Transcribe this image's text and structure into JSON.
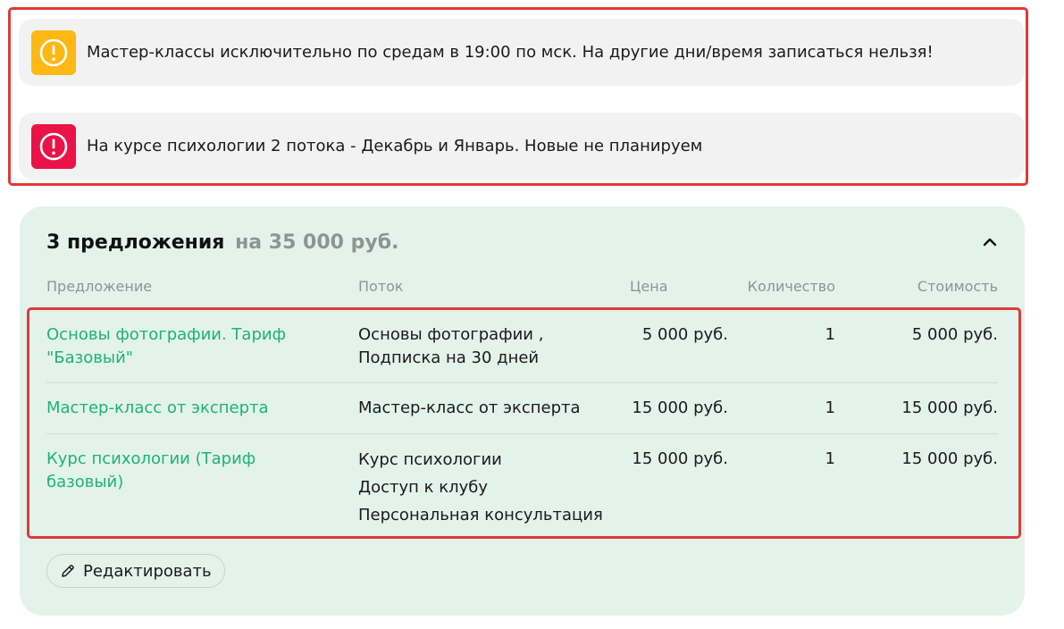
{
  "notices": [
    {
      "text": "Мастер-классы исключительно по средам в 19:00 по мск. На другие дни/время записаться нельзя!",
      "icon": "exclamation-circle-icon",
      "color": "#fdb813"
    },
    {
      "text": "На курсе психологии 2 потока - Декабрь и Январь. Новые не планируем",
      "icon": "exclamation-circle-icon",
      "color": "#eb1248"
    }
  ],
  "offers": {
    "title_count": "3 предложения",
    "title_total": "на 35 000 руб.",
    "collapse_icon": "chevron-up-icon",
    "columns": {
      "offer": "Предложение",
      "stream": "Поток",
      "price": "Цена",
      "quantity": "Количество",
      "cost": "Стоимость"
    },
    "rows": [
      {
        "offer": "Основы фотографии. Тариф \"Базовый\"",
        "stream": [
          "Основы фотографии ,",
          "Подписка на 30 дней"
        ],
        "price": "5 000 руб.",
        "quantity": "1",
        "cost": "5 000 руб."
      },
      {
        "offer": "Мастер-класс от эксперта",
        "stream": [
          "Мастер-класс от эксперта"
        ],
        "price": "15 000 руб.",
        "quantity": "1",
        "cost": "15 000 руб."
      },
      {
        "offer": "Курс психологии (Тариф базовый)",
        "stream": [
          "Курс психологии",
          "Доступ к клубу",
          "Персональная консультация"
        ],
        "price": "15 000 руб.",
        "quantity": "1",
        "cost": "15 000 руб."
      }
    ],
    "edit_label": "Редактировать",
    "edit_icon": "pencil-icon"
  },
  "colors": {
    "accent_green": "#1eb27a",
    "card_bg": "#e3f3ec",
    "highlight_red": "#dc3b3b"
  }
}
